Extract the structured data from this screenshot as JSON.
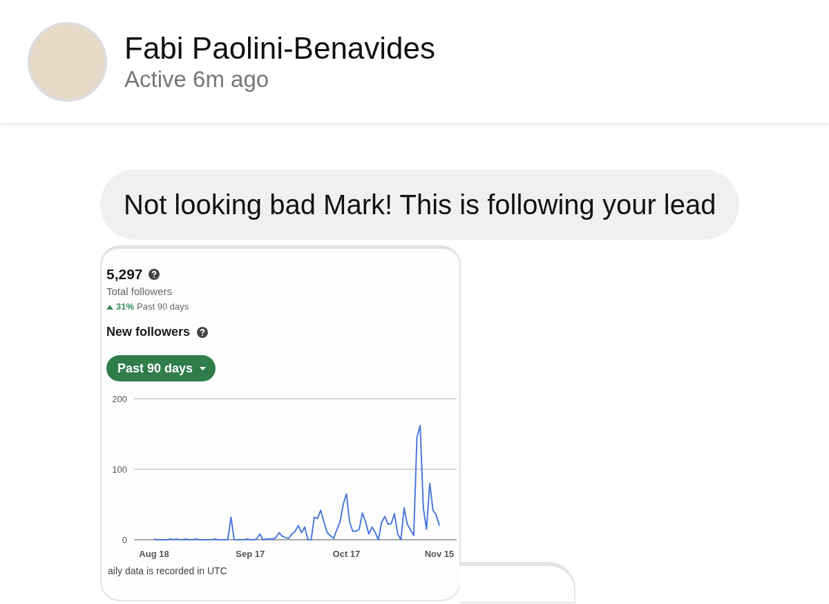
{
  "header": {
    "name": "Fabi Paolini-Benavides",
    "status": "Active 6m ago"
  },
  "messages": [
    {
      "kind": "text",
      "text": "Not looking bad Mark! This is following your lead"
    },
    {
      "kind": "image",
      "total": "5,297",
      "total_label": "Total followers",
      "change": "31%",
      "change_period": "Past 90 days",
      "section_title": "New followers",
      "range_button": "Past 90 days",
      "footer": "aily data is recorded in UTC",
      "chart_data": {
        "type": "line",
        "categories": [
          "Aug 18",
          null,
          null,
          null,
          null,
          null,
          null,
          null,
          null,
          null,
          null,
          null,
          null,
          null,
          null,
          null,
          null,
          null,
          null,
          null,
          null,
          null,
          null,
          null,
          null,
          null,
          null,
          null,
          null,
          null,
          "Sep 17",
          null,
          null,
          null,
          null,
          null,
          null,
          null,
          null,
          null,
          null,
          null,
          null,
          null,
          null,
          null,
          null,
          null,
          null,
          null,
          null,
          null,
          null,
          null,
          null,
          null,
          null,
          null,
          null,
          null,
          "Oct 17",
          null,
          null,
          null,
          null,
          null,
          null,
          null,
          null,
          null,
          null,
          null,
          null,
          null,
          null,
          null,
          null,
          null,
          null,
          null,
          null,
          null,
          null,
          null,
          null,
          null,
          null,
          null,
          null,
          "Nov 15"
        ],
        "series": [
          {
            "color": "#4a78dc",
            "values": [
              1,
              0,
              0,
              0,
              0,
              1,
              0,
              1,
              0,
              0,
              1,
              0,
              0,
              1,
              0,
              0,
              0,
              0,
              0,
              1,
              0,
              0,
              0,
              0,
              32,
              0,
              0,
              0,
              0,
              1,
              0,
              0,
              1,
              8,
              0,
              1,
              1,
              1,
              3,
              10,
              5,
              3,
              2,
              8,
              12,
              20,
              10,
              18,
              0,
              0,
              32,
              30,
              42,
              25,
              10,
              6,
              2,
              14,
              25,
              50,
              65,
              25,
              12,
              12,
              15,
              38,
              25,
              8,
              18,
              10,
              0,
              25,
              33,
              22,
              23,
              37,
              8,
              0,
              45,
              22,
              14,
              6,
              145,
              162,
              45,
              15,
              80,
              42,
              35,
              20
            ]
          }
        ],
        "ylim": [
          0,
          200
        ],
        "yticks": [
          0,
          100,
          200
        ]
      }
    },
    {
      "kind": "partial"
    }
  ]
}
